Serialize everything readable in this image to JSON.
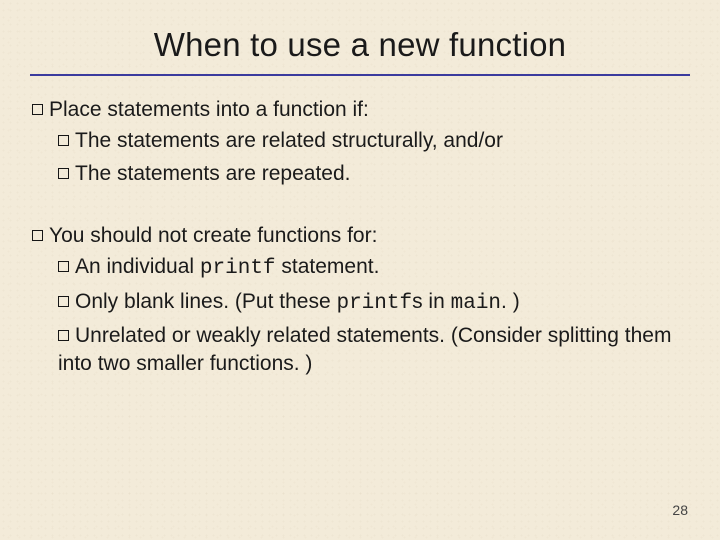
{
  "title": "When to use a new function",
  "group1": {
    "head": "Place statements into a function if:",
    "items": [
      "The statements are related structurally, and/or",
      "The statements are repeated."
    ]
  },
  "group2": {
    "head": "You should not create functions for:",
    "items": [
      {
        "pre": "An individual ",
        "code": "printf",
        "post": " statement."
      },
      {
        "pre": "Only blank lines. (Put these ",
        "code": "printf",
        "post": "s in ",
        "code2": "main",
        "post2": ". )"
      },
      {
        "pre": "Unrelated or weakly related statements. (Consider splitting them into two smaller functions. )"
      }
    ]
  },
  "page_number": "28"
}
